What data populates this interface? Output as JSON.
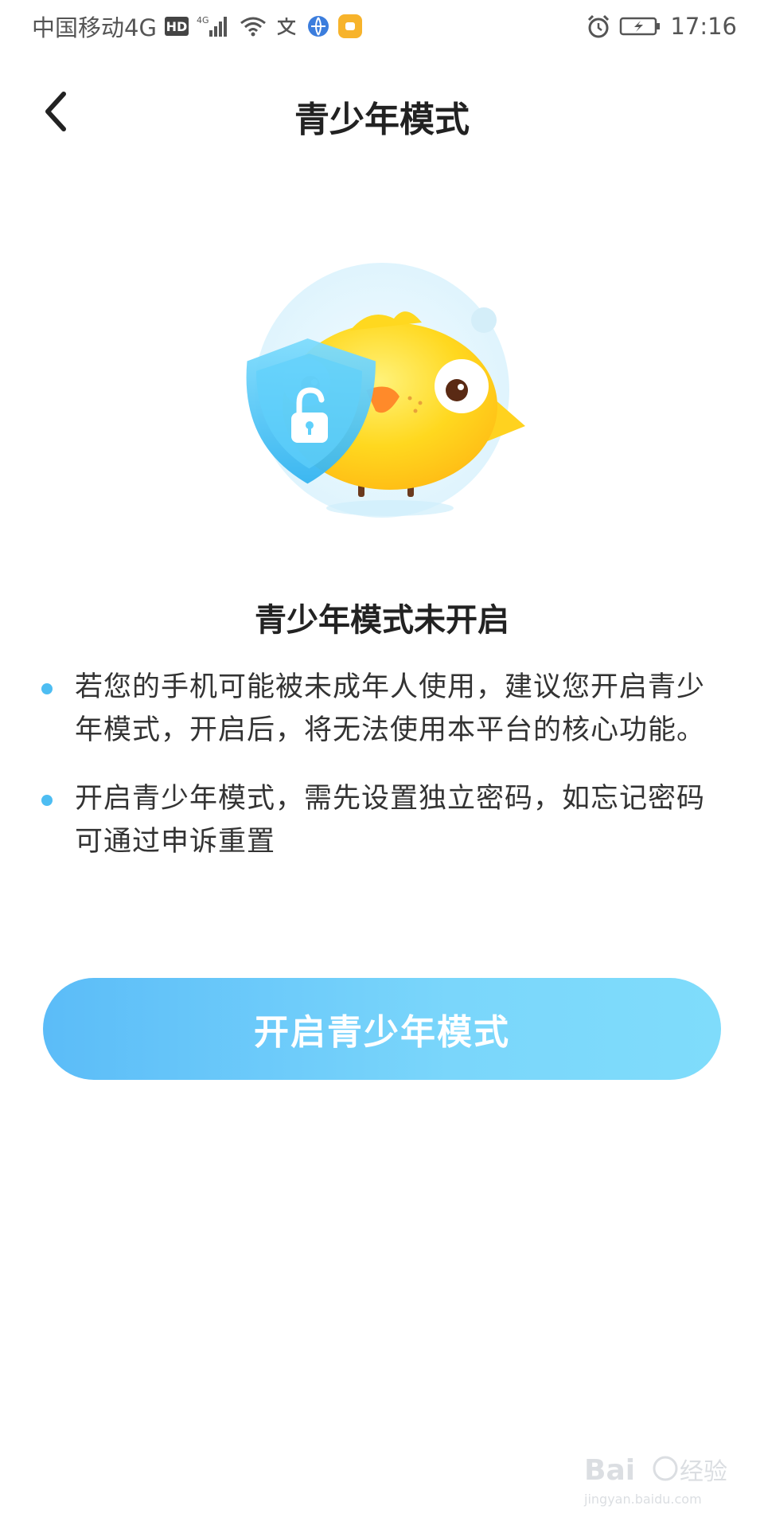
{
  "status_bar": {
    "carrier": "中国移动4G",
    "hd_label": "HD",
    "network_label": "4G",
    "time": "17:16"
  },
  "nav": {
    "title": "青少年模式"
  },
  "content": {
    "title": "青少年模式未开启",
    "tips": [
      "若您的手机可能被未成年人使用，建议您开启青少年模式，开启后，将无法使用本平台的核心功能。",
      "开启青少年模式，需先设置独立密码，如忘记密码可通过申诉重置"
    ]
  },
  "actions": {
    "enable_label": "开启青少年模式"
  },
  "watermark": {
    "brand": "Baidu经验",
    "url": "jingyan.baidu.com"
  },
  "colors": {
    "accent": "#4dbdf2",
    "button_start": "#5bbcf8",
    "button_end": "#7fdcfb",
    "bird": "#ffd21f",
    "shield": "#4fc3f7"
  },
  "icons": {
    "back": "chevron-left-icon",
    "alarm": "alarm-icon",
    "battery": "battery-charging-icon",
    "wifi": "wifi-icon",
    "signal": "signal-icon"
  }
}
